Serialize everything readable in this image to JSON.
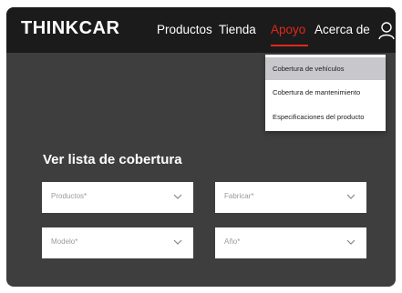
{
  "header": {
    "logo": "THINKCAR",
    "nav": [
      "Productos",
      "Tienda",
      "Apoyo",
      "Acerca de"
    ],
    "active_nav": "Apoyo",
    "accent_color": "#e0281e"
  },
  "dropdown": {
    "items": [
      "Cobertura de vehículos",
      "Cobertura de mantenimiento",
      "Especificaciones del producto"
    ],
    "highlighted": "Cobertura de vehículos"
  },
  "coverage": {
    "title": "Ver lista de cobertura",
    "fields": {
      "productos": "Productos*",
      "fabricar": "Fabricar*",
      "modelo": "Modelo*",
      "anio": "Año*"
    }
  },
  "icons": {
    "user": "user-icon",
    "chevron": "chevron-down-icon"
  }
}
